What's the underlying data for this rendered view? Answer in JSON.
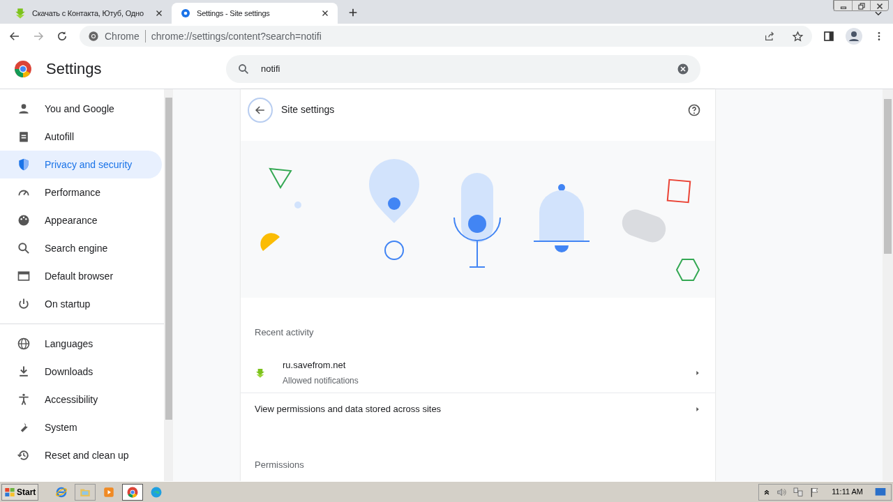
{
  "tabs": [
    {
      "title": "Скачать с Контакта, Ютуб, Одно",
      "selected": false
    },
    {
      "title": "Settings - Site settings",
      "selected": true
    }
  ],
  "address_bar": {
    "site_label": "Chrome",
    "url": "chrome://settings/content?search=notifi"
  },
  "header": {
    "title": "Settings",
    "search": {
      "value": "notifi"
    }
  },
  "sidebar": {
    "items": [
      {
        "label": "You and Google",
        "selected": false
      },
      {
        "label": "Autofill",
        "selected": false
      },
      {
        "label": "Privacy and security",
        "selected": true
      },
      {
        "label": "Performance",
        "selected": false
      },
      {
        "label": "Appearance",
        "selected": false
      },
      {
        "label": "Search engine",
        "selected": false
      },
      {
        "label": "Default browser",
        "selected": false
      },
      {
        "label": "On startup",
        "selected": false
      },
      {
        "label": "Languages",
        "selected": false
      },
      {
        "label": "Downloads",
        "selected": false
      },
      {
        "label": "Accessibility",
        "selected": false
      },
      {
        "label": "System",
        "selected": false
      },
      {
        "label": "Reset and clean up",
        "selected": false
      }
    ]
  },
  "page": {
    "title": "Site settings",
    "recent_activity": {
      "heading": "Recent activity",
      "items": [
        {
          "site": "ru.savefrom.net",
          "detail": "Allowed notifications"
        }
      ]
    },
    "links": [
      "View permissions and data stored across sites"
    ],
    "permissions_heading": "Permissions"
  },
  "taskbar": {
    "start": "Start",
    "clock": "11:11 AM"
  }
}
